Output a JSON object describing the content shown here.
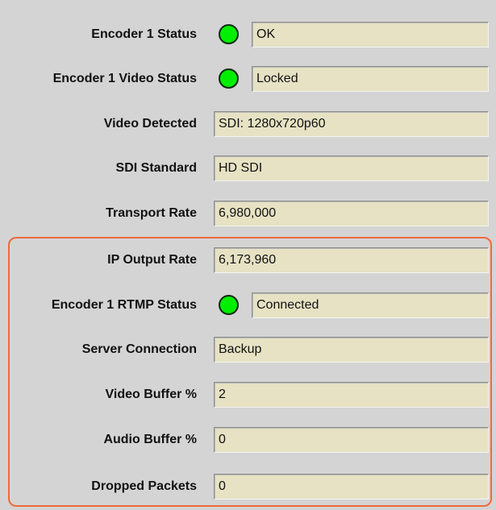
{
  "status_panel": {
    "rows": [
      {
        "label": "Encoder 1 Status",
        "value": "OK",
        "led": true
      },
      {
        "label": "Encoder 1 Video Status",
        "value": "Locked",
        "led": true
      },
      {
        "label": "Video Detected",
        "value": "SDI: 1280x720p60",
        "led": false
      },
      {
        "label": "SDI Standard",
        "value": "HD SDI",
        "led": false
      },
      {
        "label": "Transport Rate",
        "value": "6,980,000",
        "led": false
      },
      {
        "label": "IP Output Rate",
        "value": "6,173,960",
        "led": false
      },
      {
        "label": "Encoder 1 RTMP Status",
        "value": "Connected",
        "led": true
      },
      {
        "label": "Server Connection",
        "value": "Backup",
        "led": false
      },
      {
        "label": "Video Buffer %",
        "value": "2",
        "led": false
      },
      {
        "label": "Audio Buffer %",
        "value": "0",
        "led": false
      },
      {
        "label": "Dropped Packets",
        "value": "0",
        "led": false
      }
    ]
  },
  "colors": {
    "led_on": "#00ee00",
    "field_background": "#e6e2c3",
    "highlight_border": "#f06a3a",
    "panel_background": "#d4d4d4"
  },
  "icons": {
    "status_led": "green-status-led-icon"
  }
}
